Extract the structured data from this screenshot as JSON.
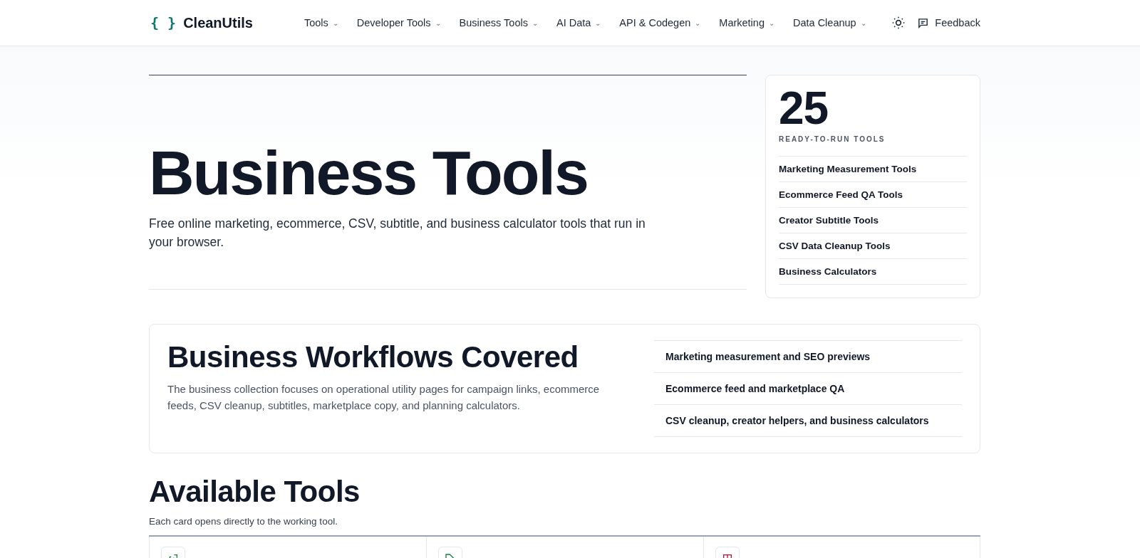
{
  "header": {
    "logo_mark": "{ }",
    "logo_text": "CleanUtils",
    "nav": [
      {
        "label": "Tools",
        "caret": "⌄"
      },
      {
        "label": "Developer Tools",
        "caret": "⌄"
      },
      {
        "label": "Business Tools",
        "caret": "⌄"
      },
      {
        "label": "AI Data",
        "caret": "⌄"
      },
      {
        "label": "API & Codegen",
        "caret": "⌄"
      },
      {
        "label": "Marketing",
        "caret": "⌄"
      },
      {
        "label": "Data Cleanup",
        "caret": "⌄"
      }
    ],
    "feedback": "Feedback"
  },
  "hero": {
    "title": "Business Tools",
    "subtitle": "Free online marketing, ecommerce, CSV, subtitle, and business calculator tools that run in your browser."
  },
  "stats": {
    "count": "25",
    "caption": "READY-TO-RUN TOOLS",
    "links": [
      "Marketing Measurement Tools",
      "Ecommerce Feed QA Tools",
      "Creator Subtitle Tools",
      "CSV Data Cleanup Tools",
      "Business Calculators"
    ]
  },
  "workflows": {
    "title": "Business Workflows Covered",
    "text": "The business collection focuses on operational utility pages for campaign links, ecommerce feeds, CSV cleanup, subtitles, marketplace copy, and planning calculators.",
    "items": [
      "Marketing measurement and SEO previews",
      "Ecommerce feed and marketplace QA",
      "CSV cleanup, creator helpers, and business calculators"
    ]
  },
  "available": {
    "title": "Available Tools",
    "subtitle": "Each card opens directly to the working tool.",
    "cards": [
      {
        "kind": "link"
      },
      {
        "kind": "tag"
      },
      {
        "kind": "grid"
      }
    ]
  }
}
